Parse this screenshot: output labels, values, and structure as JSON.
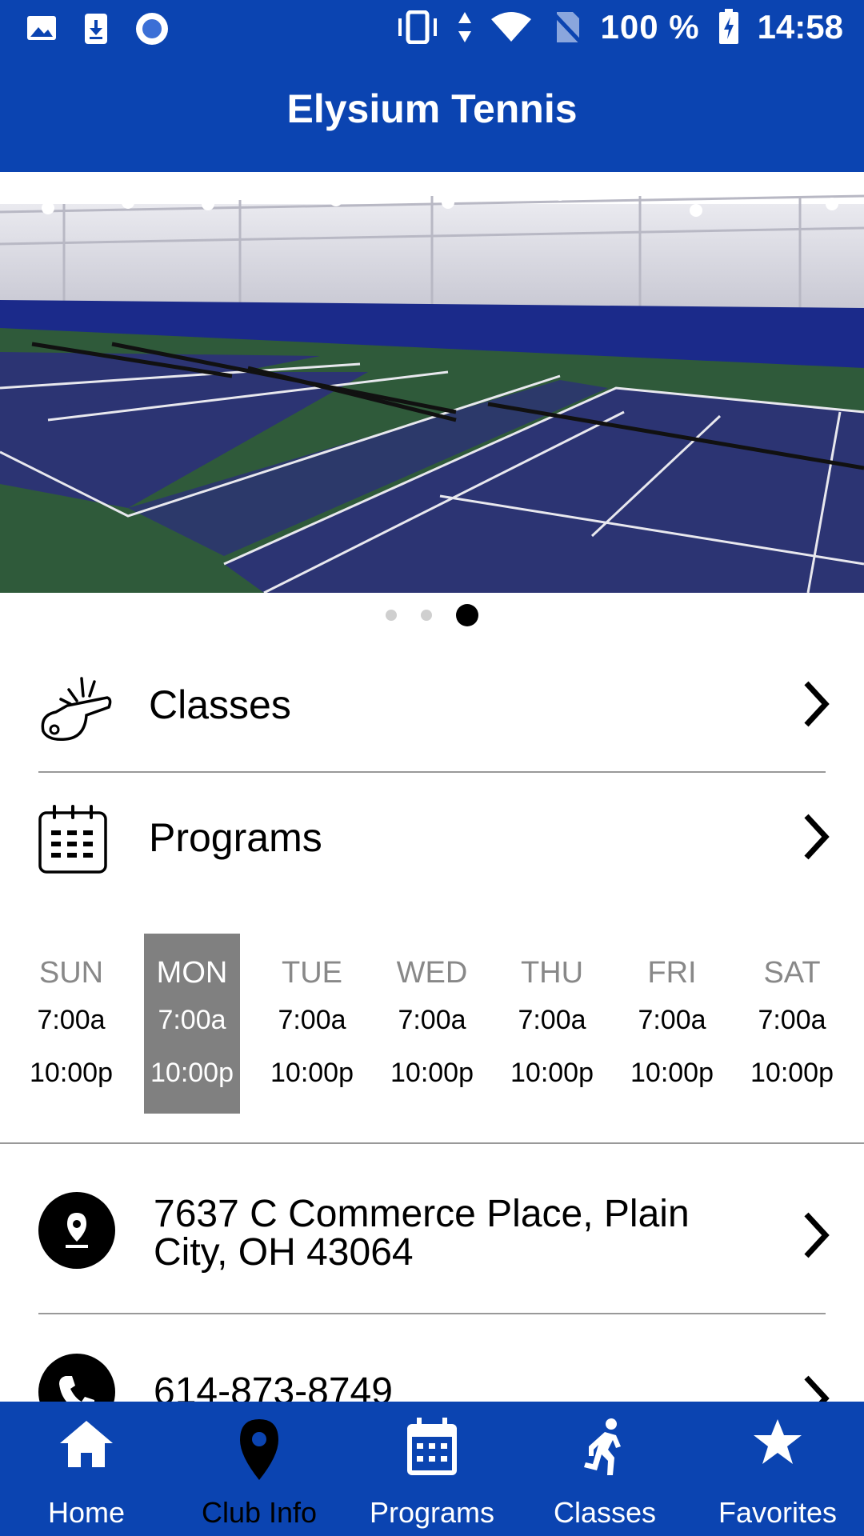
{
  "status_bar": {
    "battery_percent": "100 %",
    "time": "14:58",
    "icons": [
      "image-icon",
      "download-icon",
      "record-icon",
      "vibrate-icon",
      "data-arrows-icon",
      "wifi-icon",
      "no-sim-icon",
      "battery-charging-icon"
    ]
  },
  "app_bar": {
    "title": "Elysium Tennis"
  },
  "carousel": {
    "pages": 3,
    "active_index": 2
  },
  "menu": [
    {
      "label": "Classes",
      "icon": "whistle-icon"
    },
    {
      "label": "Programs",
      "icon": "calendar-icon"
    }
  ],
  "hours": {
    "active_day": "MON",
    "days": [
      {
        "name": "SUN",
        "open": "7:00a",
        "close": "10:00p"
      },
      {
        "name": "MON",
        "open": "7:00a",
        "close": "10:00p"
      },
      {
        "name": "TUE",
        "open": "7:00a",
        "close": "10:00p"
      },
      {
        "name": "WED",
        "open": "7:00a",
        "close": "10:00p"
      },
      {
        "name": "THU",
        "open": "7:00a",
        "close": "10:00p"
      },
      {
        "name": "FRI",
        "open": "7:00a",
        "close": "10:00p"
      },
      {
        "name": "SAT",
        "open": "7:00a",
        "close": "10:00p"
      }
    ]
  },
  "contact": {
    "address": "7637 C Commerce Place, Plain City, OH 43064",
    "phone": "614-873-8749"
  },
  "bottom_nav": {
    "active": "Club Info",
    "items": [
      {
        "label": "Home",
        "icon": "home-icon"
      },
      {
        "label": "Club Info",
        "icon": "map-pin-icon"
      },
      {
        "label": "Programs",
        "icon": "calendar-icon"
      },
      {
        "label": "Classes",
        "icon": "runner-icon"
      },
      {
        "label": "Favorites",
        "icon": "star-icon"
      }
    ]
  },
  "colors": {
    "brand_blue": "#0b44b1",
    "active_day_bg": "#808080"
  }
}
